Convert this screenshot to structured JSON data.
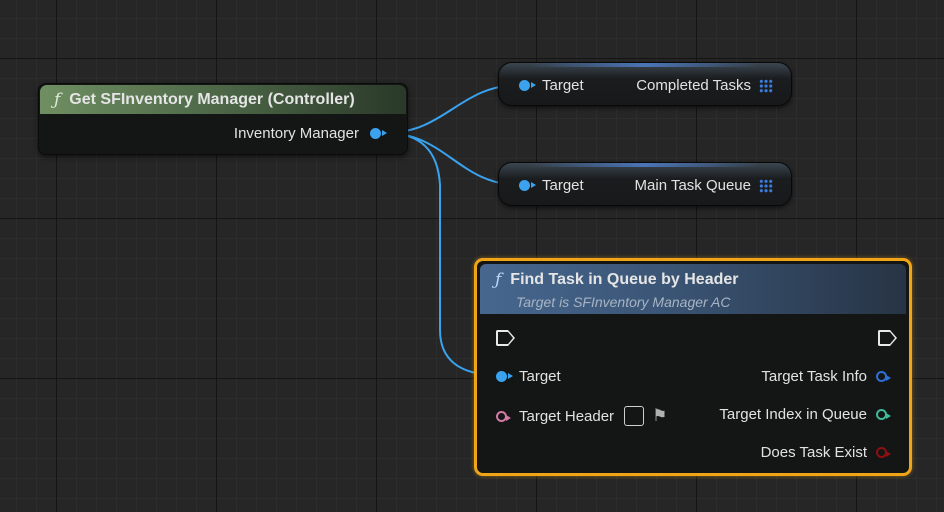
{
  "get_node": {
    "title": "Get SFInventory Manager (Controller)",
    "output_label": "Inventory Manager"
  },
  "completed_node": {
    "input_label": "Target",
    "output_label": "Completed Tasks"
  },
  "main_queue_node": {
    "input_label": "Target",
    "output_label": "Main Task Queue"
  },
  "find_node": {
    "title": "Find Task in Queue by Header",
    "subtitle": "Target is SFInventory Manager AC",
    "inputs": {
      "target": "Target",
      "target_header": "Target Header"
    },
    "outputs": {
      "task_info": "Target Task Info",
      "index_in_queue": "Target Index in Queue",
      "does_exist": "Does Task Exist"
    }
  },
  "colors": {
    "object_pin": "#3aa2ee",
    "text_pin": "#d27aa3",
    "struct_pin": "#2e6fd8",
    "int_pin": "#3fb99a",
    "bool_pin": "#8c1010",
    "selection_outline": "#f0a518",
    "pure_header": "#6f8f62",
    "function_header": "#47678f"
  },
  "icons": {
    "function": "function-f-icon",
    "array": "array-grid-icon",
    "exec": "exec-arrow-icon",
    "flag": "flag-icon"
  }
}
